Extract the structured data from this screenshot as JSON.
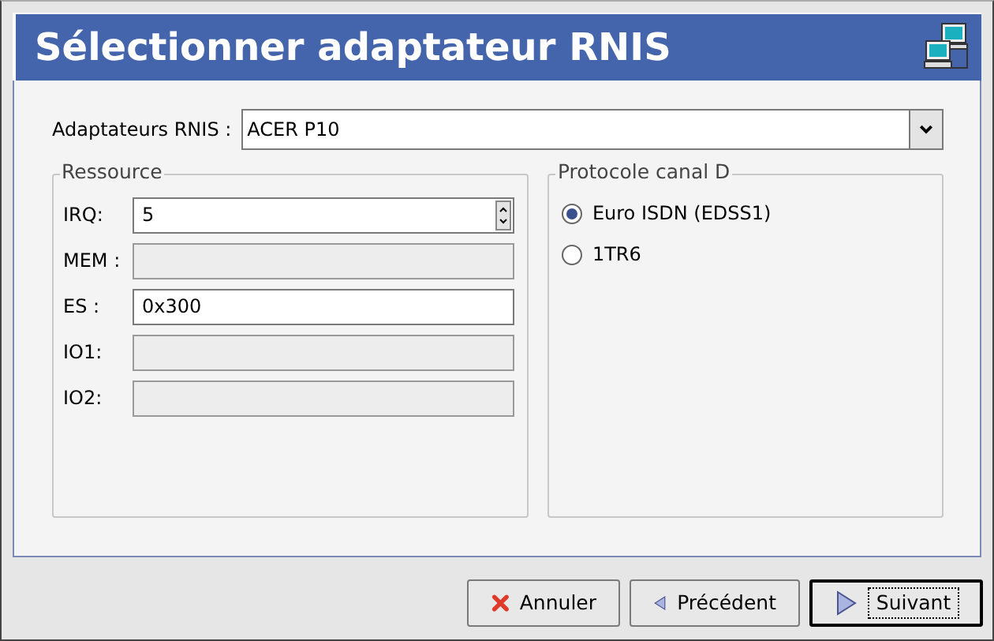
{
  "window": {
    "title": "Sélectionner adaptateur RNIS"
  },
  "adapter": {
    "label": "Adaptateurs RNIS :",
    "value": "ACER P10"
  },
  "resource": {
    "title": "Ressource",
    "fields": [
      {
        "kind": "spin",
        "label": "IRQ:",
        "value": "5",
        "disabled": false
      },
      {
        "kind": "text",
        "label": "MEM :",
        "disabled": true
      },
      {
        "kind": "text",
        "label": "ES :",
        "value": "0x300",
        "disabled": false
      },
      {
        "kind": "text",
        "label": "IO1:",
        "disabled": true
      },
      {
        "kind": "text",
        "label": "IO2:",
        "disabled": true
      }
    ]
  },
  "protocol": {
    "title": "Protocole canal D",
    "options": [
      {
        "label": "Euro ISDN (EDSS1)",
        "selected": true
      },
      {
        "label": "1TR6",
        "selected": false
      }
    ]
  },
  "buttons": [
    {
      "kind": "cancel",
      "label": "Annuler",
      "focused": false
    },
    {
      "kind": "back",
      "label": "Précédent",
      "focused": false
    },
    {
      "kind": "next",
      "label": "Suivant",
      "focused": true
    }
  ]
}
